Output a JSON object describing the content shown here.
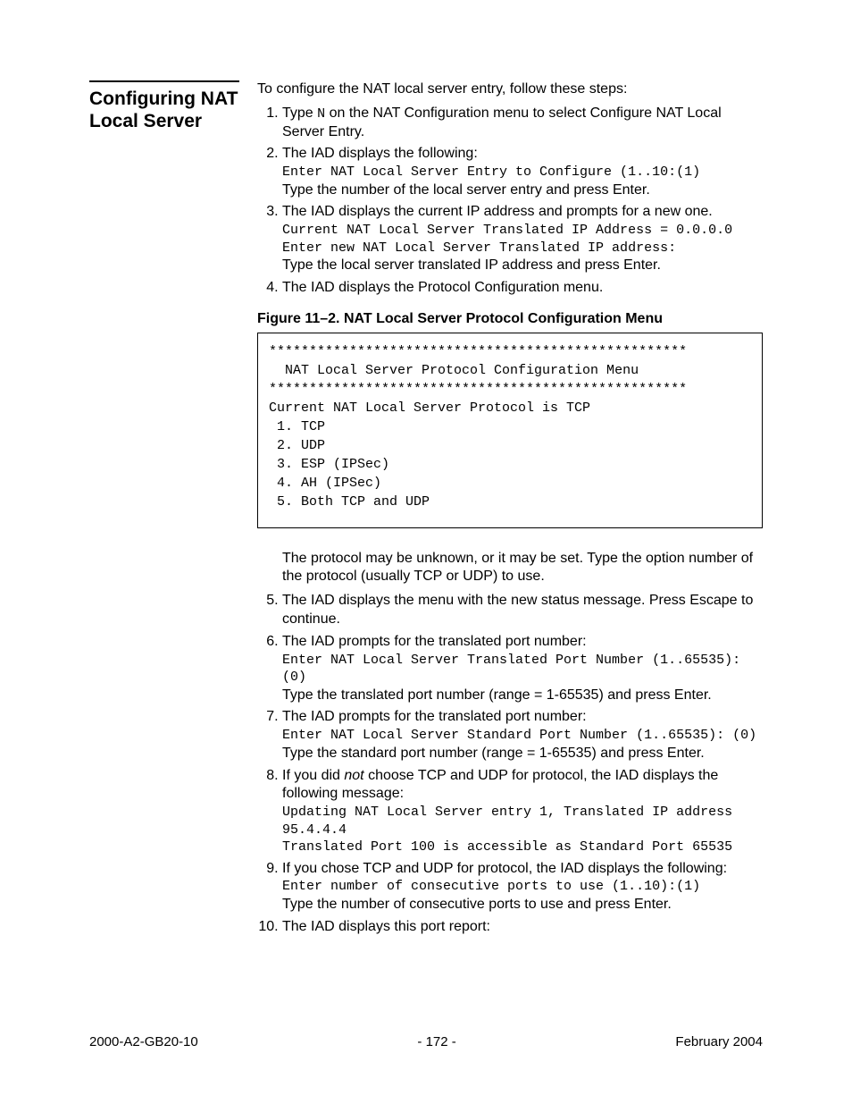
{
  "sectionTitle": "Configuring NAT Local Server",
  "intro": "To configure the NAT local server entry, follow these steps:",
  "step1_a": "Type ",
  "step1_code": "N",
  "step1_b": " on the NAT Configuration menu to select Configure NAT Local Server Entry.",
  "step2_a": "The IAD displays the following:",
  "step2_code": "Enter NAT Local Server Entry to Configure (1..10:(1)",
  "step2_b": "Type the number of the local server entry and press Enter.",
  "step3_a": "The IAD displays the current IP address and prompts for a new one.",
  "step3_code1": "Current NAT Local Server Translated IP Address = 0.0.0.0",
  "step3_code2": "Enter new NAT Local Server Translated IP address:",
  "step3_b": "Type the local server translated IP address and press Enter.",
  "step4_a": "The IAD displays the Protocol Configuration menu.",
  "figureCaption": "Figure 11–2.  NAT Local Server Protocol Configuration Menu",
  "consoleBox": "****************************************************\n  NAT Local Server Protocol Configuration Menu\n****************************************************\nCurrent NAT Local Server Protocol is TCP\n 1. TCP\n 2. UDP\n 3. ESP (IPSec)\n 4. AH (IPSec)\n 5. Both TCP and UDP",
  "afterBox": "The protocol may be unknown, or it may be set. Type the option number of the protocol (usually TCP or UDP) to use.",
  "step5": "The IAD displays the menu with the new status message. Press Escape to continue.",
  "step6_a": "The IAD prompts for the translated port number:",
  "step6_code": "Enter NAT Local Server Translated Port Number (1..65535): (0)",
  "step6_b": "Type the translated port number (range = 1-65535) and press Enter.",
  "step7_a": "The IAD prompts for the translated port number:",
  "step7_code": "Enter NAT Local Server Standard Port Number (1..65535): (0)",
  "step7_b": "Type the standard port number (range = 1-65535) and press Enter.",
  "step8_a": "If you did ",
  "step8_not": "not",
  "step8_b": " choose TCP and UDP for protocol, the IAD displays the following message:",
  "step8_code1": "Updating NAT Local Server entry 1, Translated IP address 95.4.4.4",
  "step8_code2": "Translated Port 100 is accessible as Standard Port 65535",
  "step9_a": "If you chose TCP and UDP for protocol, the IAD displays the following:",
  "step9_code": "Enter number of consecutive ports to use (1..10):(1)",
  "step9_b": "Type the number of consecutive ports to use and press Enter.",
  "step10": "The IAD displays this port report:",
  "footerLeft": "2000-A2-GB20-10",
  "footerCenter": "- 172 -",
  "footerRight": "February 2004"
}
